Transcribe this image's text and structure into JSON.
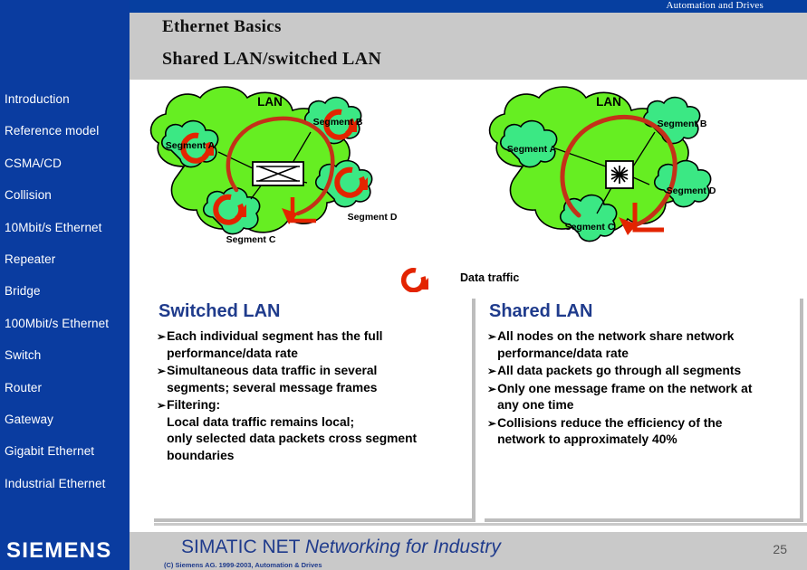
{
  "header": {
    "top_right_label": "Automation and Drives",
    "title_main": "Ethernet Basics",
    "title_sub": "Shared LAN/switched LAN"
  },
  "sidebar": {
    "items": [
      {
        "label": "Introduction"
      },
      {
        "label": "Reference model"
      },
      {
        "label": "CSMA/CD"
      },
      {
        "label": "Collision"
      },
      {
        "label": "10Mbit/s Ethernet"
      },
      {
        "label": "Repeater"
      },
      {
        "label": "Bridge"
      },
      {
        "label": "100Mbit/s Ethernet"
      },
      {
        "label": "Switch"
      },
      {
        "label": "Router"
      },
      {
        "label": "Gateway"
      },
      {
        "label": "Gigabit Ethernet"
      },
      {
        "label": "Industrial Ethernet"
      }
    ],
    "logo": "SIEMENS"
  },
  "diagram": {
    "left": {
      "lan_label": "LAN",
      "device_icon": "switch-icon",
      "segments": [
        {
          "label": "Segment A"
        },
        {
          "label": "Segment B"
        },
        {
          "label": "Segment C"
        },
        {
          "label": "Segment D"
        }
      ]
    },
    "right": {
      "lan_label": "LAN",
      "device_icon": "hub-icon",
      "segments": [
        {
          "label": "Segment A"
        },
        {
          "label": "Segment B"
        },
        {
          "label": "Segment C"
        },
        {
          "label": "Segment D"
        }
      ]
    },
    "legend": {
      "icon": "data-traffic-arrow-icon",
      "label": "Data traffic"
    },
    "colors": {
      "lan_cloud": "#66EE22",
      "segment_cloud": "#3BE884",
      "traffic_arrow": "#E32400",
      "outline": "#000000"
    }
  },
  "columns": [
    {
      "heading": "Switched LAN",
      "bullets": [
        "Each individual segment has the full\nperformance/data rate",
        "Simultaneous data traffic in several\nsegments; several message frames",
        "Filtering:\nLocal data traffic remains local;\nonly selected data packets cross segment\nboundaries"
      ]
    },
    {
      "heading": "Shared LAN",
      "bullets": [
        "All nodes on the network share network\nperformance/data rate",
        "All data packets go through all segments",
        "Only one message frame on the network at\nany one time",
        "Collisions reduce the efficiency of the\nnetwork to approximately 40%"
      ]
    }
  ],
  "bullet_mark": "➢",
  "footer": {
    "title_regular": "SIMATIC NET ",
    "title_italic": "Networking for Industry",
    "copyright": "(C) Siemens AG. 1999-2003, Automation & Drives",
    "page_number": "25"
  }
}
